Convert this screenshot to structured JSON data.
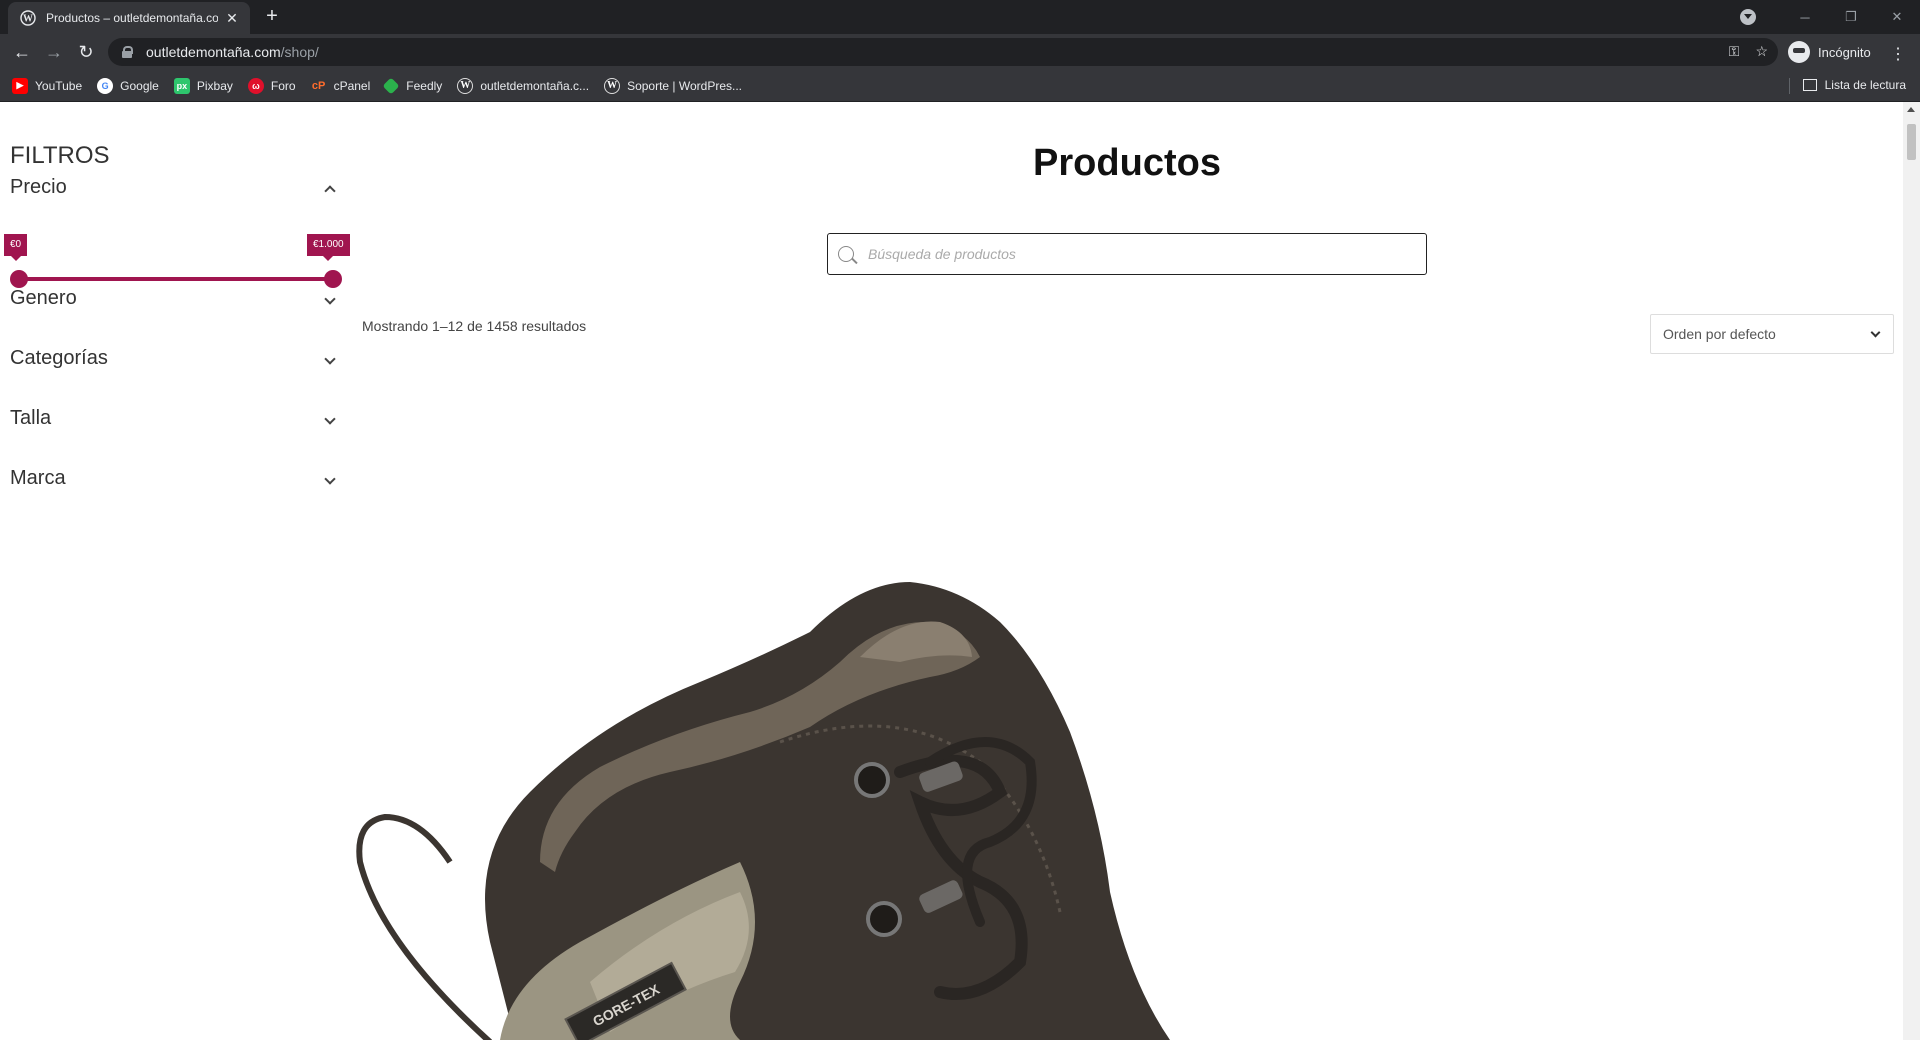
{
  "browser": {
    "tab_title": "Productos – outletdemontaña.co",
    "url_host": "outletdemontaña.com",
    "url_path": "/shop/",
    "profile_label": "Incógnito",
    "bookmarks": [
      {
        "label": "YouTube",
        "icon": "youtube-icon",
        "color": "#ff0000"
      },
      {
        "label": "Google",
        "icon": "google-icon",
        "color": "#ffffff"
      },
      {
        "label": "Pixbay",
        "icon": "pixabay-icon",
        "color": "#2ec66d"
      },
      {
        "label": "Foro",
        "icon": "forum-icon",
        "color": "#e0102b"
      },
      {
        "label": "cPanel",
        "icon": "cpanel-icon",
        "color": "#ff6c2c"
      },
      {
        "label": "Feedly",
        "icon": "feedly-icon",
        "color": "#2bb24c"
      },
      {
        "label": "outletdemontaña.c...",
        "icon": "wordpress-icon",
        "color": "#dddddd"
      },
      {
        "label": "Soporte | WordPres...",
        "icon": "wordpress-icon",
        "color": "#dddddd"
      }
    ],
    "reading_list_label": "Lista de lectura"
  },
  "sidebar": {
    "title": "FILTROS",
    "price": {
      "label": "Precio",
      "min_label": "€0",
      "max_label": "€1.000",
      "min_fraction": 0.0,
      "max_fraction": 1.0
    },
    "facets": [
      {
        "label": "Genero"
      },
      {
        "label": "Categorías"
      },
      {
        "label": "Talla"
      },
      {
        "label": "Marca"
      }
    ]
  },
  "main": {
    "title": "Productos",
    "search_placeholder": "Búsqueda de productos",
    "results_text": "Mostrando 1–12 de 1458 resultados",
    "sort_label": "Orden por defecto"
  },
  "product_image": {
    "logo_text": "GORE-TEX"
  },
  "colors": {
    "accent": "#a0154f"
  }
}
